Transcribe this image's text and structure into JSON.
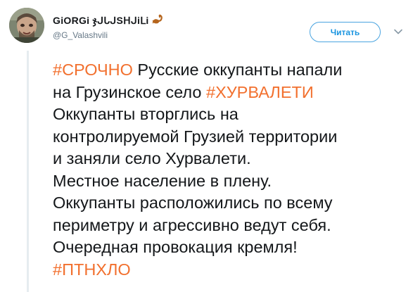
{
  "colors": {
    "hashtag": "#f2702e",
    "follow_accent": "#1b95e0",
    "text": "#14171a",
    "muted": "#657786"
  },
  "author": {
    "display_name": "GiORGi ჯᒍᒐᒍSᕼᒍiᒪi",
    "handle": "@G_Valashvili",
    "avatar_icon": "avatar-photo",
    "emoji_icon": "scorpion-icon"
  },
  "follow_button": {
    "label": "Читать"
  },
  "menu": {
    "icon": "chevron-down-icon"
  },
  "tweet": {
    "lines": [
      {
        "tag": "#СРОЧНО",
        "text": " Русские оккупанты напали"
      },
      {
        "text": "на Грузинское село ",
        "tag": "#ХУРВАЛЕТИ"
      },
      {
        "text": "Оккупанты вторглись на"
      },
      {
        "text": "контролируемой Грузией территории"
      },
      {
        "text": "и заняли село Хурвалети."
      },
      {
        "text": "Местное население в плену."
      },
      {
        "text": "Оккупанты расположились по всему"
      },
      {
        "text": "периметру и агрессивно ведут себя."
      },
      {
        "text": "Очередная провокация кремля!"
      },
      {
        "tag": "#ПТНХЛО"
      }
    ]
  }
}
